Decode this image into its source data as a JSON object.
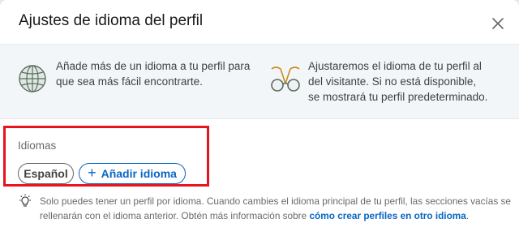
{
  "dialog": {
    "title": "Ajustes de idioma del perfil",
    "close_icon": "close-icon"
  },
  "info": {
    "left_icon": "globe-icon",
    "left_text": "Añade más de un idioma a tu perfil para que sea más fácil encontrarte.",
    "right_icon": "glasses-icon",
    "right_text": "Ajustaremos el idioma de tu perfil al del visitante. Si no está disponible, se mostrará tu perfil predeterminado."
  },
  "languages": {
    "label": "Idiomas",
    "items": [
      "Español"
    ],
    "add_label": "Añadir idioma",
    "add_icon": "plus-icon"
  },
  "tip": {
    "icon": "lightbulb-icon",
    "text": "Solo puedes tener un perfil por idioma. Cuando cambies el idioma principal de tu perfil, las secciones vacías se rellenarán con el idioma anterior. Obtén más información sobre ",
    "link": "cómo crear perfiles en otro idioma",
    "suffix": "."
  },
  "colors": {
    "accent": "#0a66c2",
    "highlight": "#e8141f",
    "info_band": "#f3f6f8"
  }
}
